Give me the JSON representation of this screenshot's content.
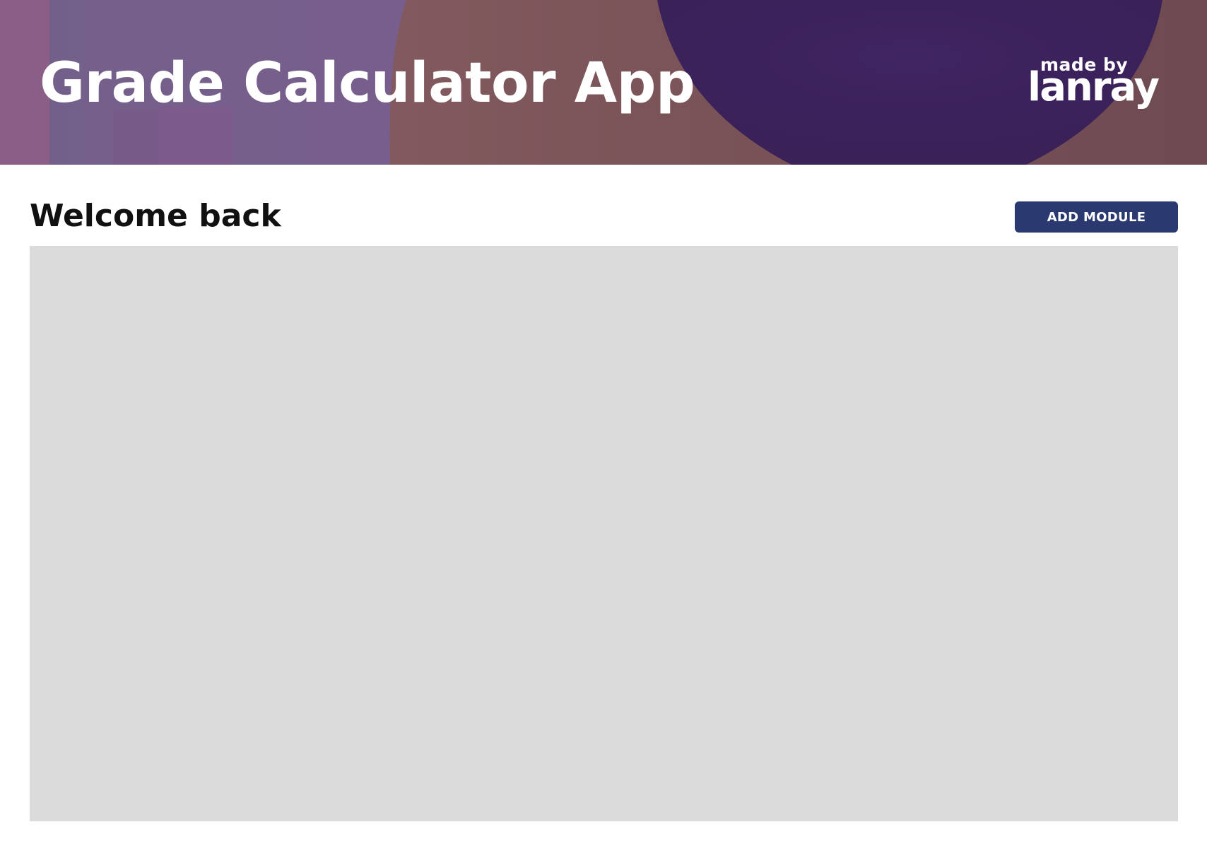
{
  "header": {
    "title": "Grade Calculator App",
    "brand": {
      "small_text": "made by",
      "large_text": "lanray"
    }
  },
  "main": {
    "heading": "Welcome back",
    "add_module_label": "ADD MODULE"
  },
  "colors": {
    "accent_button": "#2a3a70",
    "module_area": "#dbdbdb",
    "banner_purple": "#3e2360",
    "banner_mauve": "#7e5a62"
  }
}
